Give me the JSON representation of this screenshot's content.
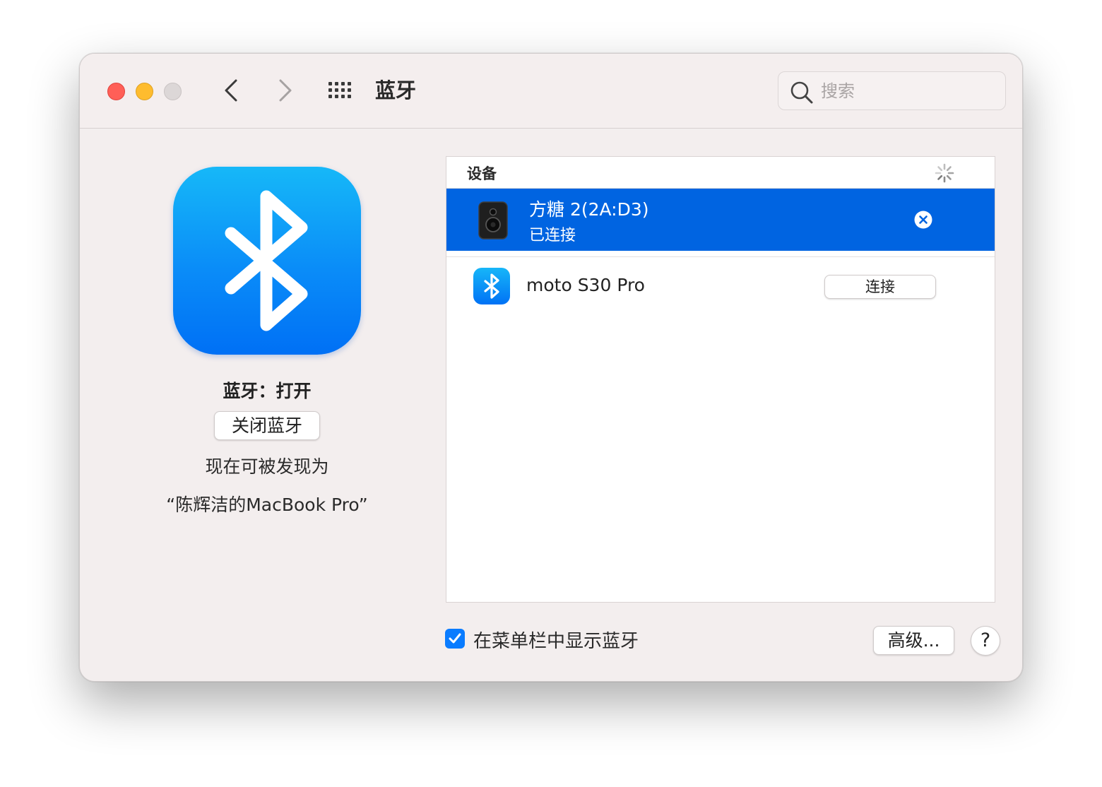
{
  "window": {
    "title": "蓝牙",
    "search_placeholder": "搜索"
  },
  "left": {
    "status": "蓝牙：打开",
    "toggle_button": "关闭蓝牙",
    "discoverable_line1": "现在可被发现为",
    "discoverable_line2": "“陈辉洁的MacBook Pro”"
  },
  "devices": {
    "header": "设备",
    "items": [
      {
        "name": "方糖 2(2A:D3)",
        "status": "已连接",
        "icon": "speaker-icon",
        "selected": true
      },
      {
        "name": "moto S30 Pro",
        "action": "连接",
        "icon": "bluetooth-icon",
        "selected": false
      }
    ]
  },
  "bottom": {
    "show_in_menubar_label": "在菜单栏中显示蓝牙",
    "show_in_menubar_checked": true,
    "advanced_button": "高级...",
    "help_button": "?"
  },
  "colors": {
    "selection": "#0064e1",
    "accent": "#0a7cff",
    "close": "#ff5f57",
    "minimize": "#febc2e"
  }
}
